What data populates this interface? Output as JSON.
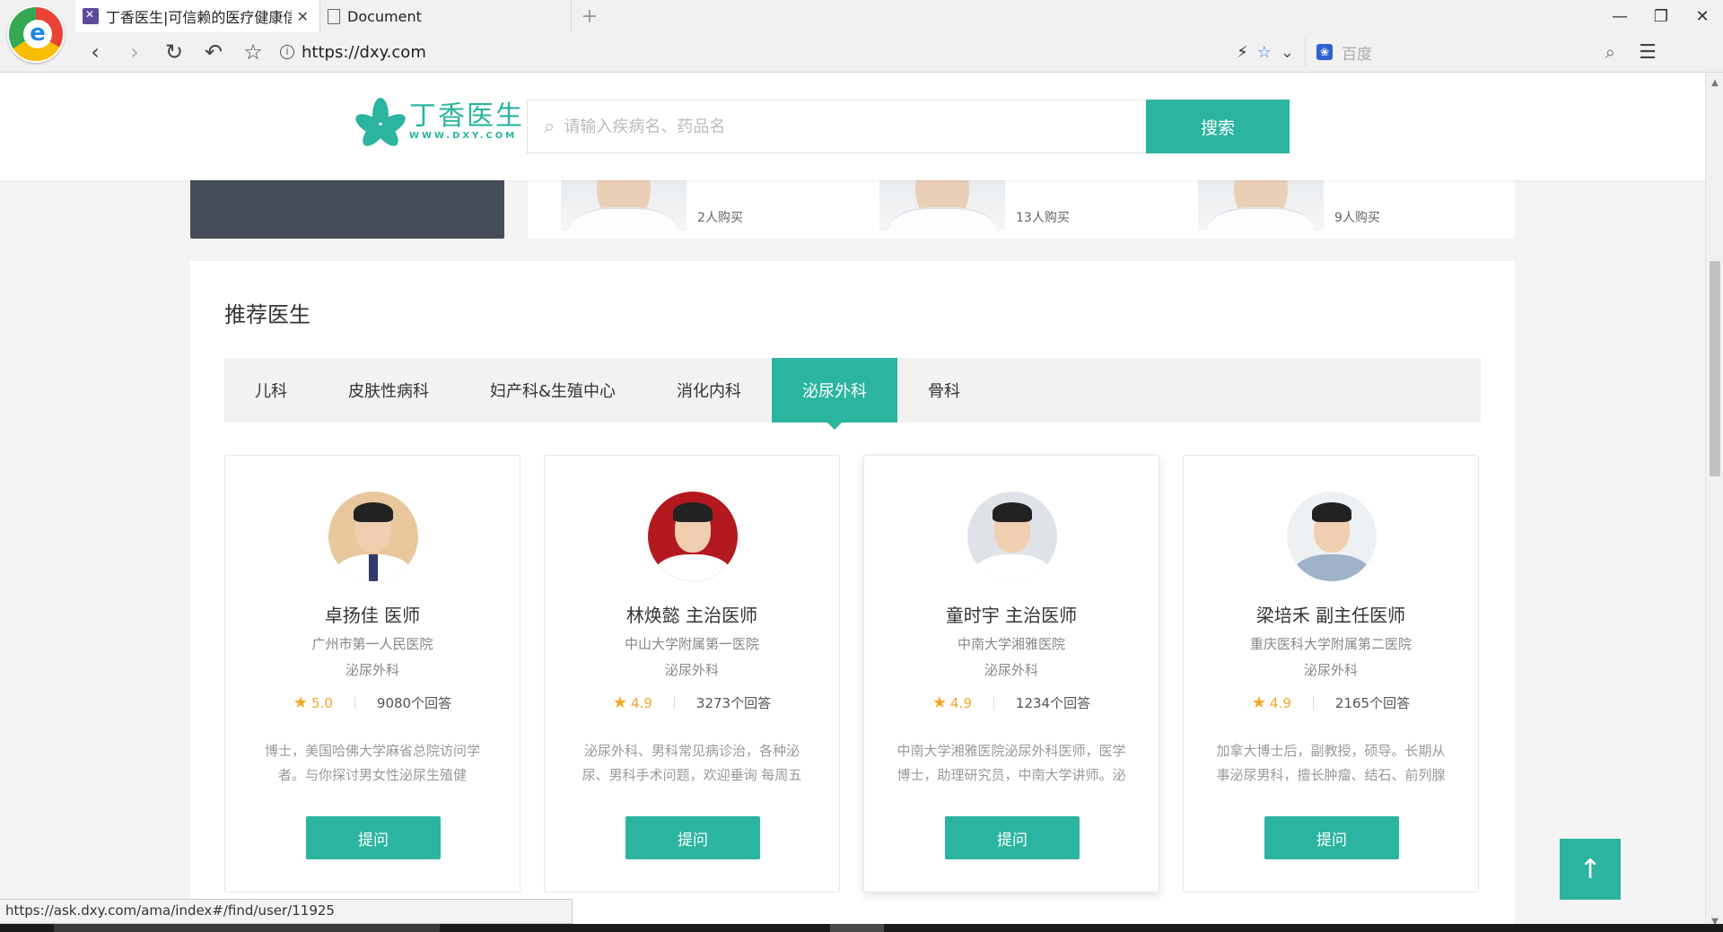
{
  "browser": {
    "tabs": [
      {
        "title": "丁香医生|可信赖的医疗健康信",
        "active": true
      },
      {
        "title": "Document",
        "active": false
      }
    ],
    "new_tab": "+",
    "url": "https://dxy.com",
    "search_engine_placeholder": "百度",
    "window_controls": {
      "minimize": "—",
      "restore": "❐",
      "close": "✕"
    },
    "nav": {
      "back": "‹",
      "forward": "›",
      "reload": "↻",
      "undo": "↶",
      "bookmark": "☆"
    }
  },
  "site": {
    "logo_cn": "丁香医生",
    "logo_en": "WWW.DXY.COM",
    "search_placeholder": "请输入疾病名、药品名",
    "search_button": "搜索"
  },
  "products": [
    {
      "buyers": "2人购买"
    },
    {
      "buyers": "13人购买"
    },
    {
      "buyers": "9人购买"
    }
  ],
  "recommend": {
    "title": "推荐医生",
    "tabs": [
      "儿科",
      "皮肤性病科",
      "妇产科&生殖中心",
      "消化内科",
      "泌尿外科",
      "骨科"
    ],
    "active_tab": "泌尿外科",
    "doctors": [
      {
        "name": "卓扬佳 医师",
        "hospital": "广州市第一人民医院",
        "dept": "泌尿外科",
        "score": "5.0",
        "answers": "9080个回答",
        "bio": "博士，美国哈佛大学麻省总院访问学者。与你探讨男女性泌尿生殖健",
        "ask": "提问",
        "avatar_bg": "#e9c79c"
      },
      {
        "name": "林焕懿 主治医师",
        "hospital": "中山大学附属第一医院",
        "dept": "泌尿外科",
        "score": "4.9",
        "answers": "3273个回答",
        "bio": "泌尿外科、男科常见病诊治，各种泌尿、男科手术问题，欢迎垂询 每周五",
        "ask": "提问",
        "avatar_bg": "#b3191f"
      },
      {
        "name": "童时宇 主治医师",
        "hospital": "中南大学湘雅医院",
        "dept": "泌尿外科",
        "score": "4.9",
        "answers": "1234个回答",
        "bio": "中南大学湘雅医院泌尿外科医师，医学博士，助理研究员，中南大学讲师。泌",
        "ask": "提问",
        "avatar_bg": "#dfe3e8"
      },
      {
        "name": "梁培禾 副主任医师",
        "hospital": "重庆医科大学附属第二医院",
        "dept": "泌尿外科",
        "score": "4.9",
        "answers": "2165个回答",
        "bio": "加拿大博士后，副教授，硕导。长期从事泌尿男科，擅长肿瘤、结石、前列腺",
        "ask": "提问",
        "avatar_bg": "#eef1f4"
      }
    ]
  },
  "to_top": "↑",
  "status_url": "https://ask.dxy.com/ama/index#/find/user/11925",
  "colors": {
    "accent": "#2bb4a0",
    "star": "#f5a623",
    "dark_card": "#474d58"
  }
}
